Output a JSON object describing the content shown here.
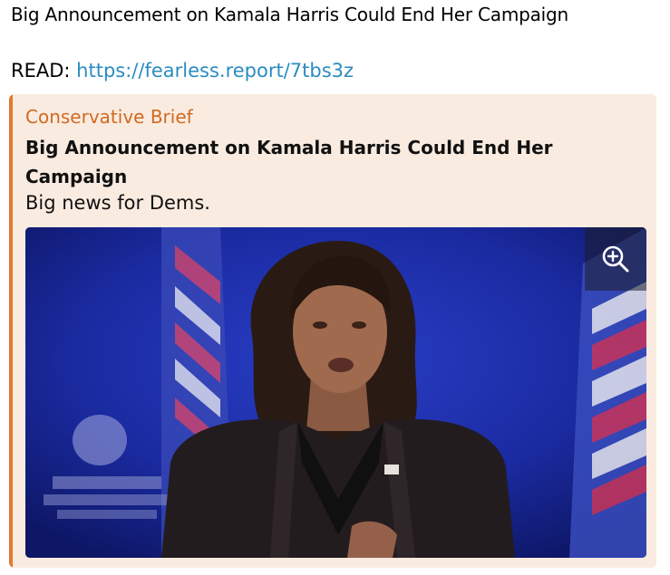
{
  "post": {
    "title": "Big Announcement on Kamala Harris Could End Her Campaign",
    "read_prefix": "READ:",
    "read_link": "https://fearless.report/7tbs3z"
  },
  "preview": {
    "site_name": "Conservative Brief",
    "title": "Big Announcement on Kamala Harris Could End Her Campaign",
    "description": "Big news for Dems.",
    "image_alt": "photo",
    "zoom_icon": "zoom-in-icon"
  },
  "colors": {
    "accent_bar": "#e07a30",
    "site_name": "#d06a22",
    "card_background": "#faebe0",
    "link": "#2b8cc0"
  }
}
